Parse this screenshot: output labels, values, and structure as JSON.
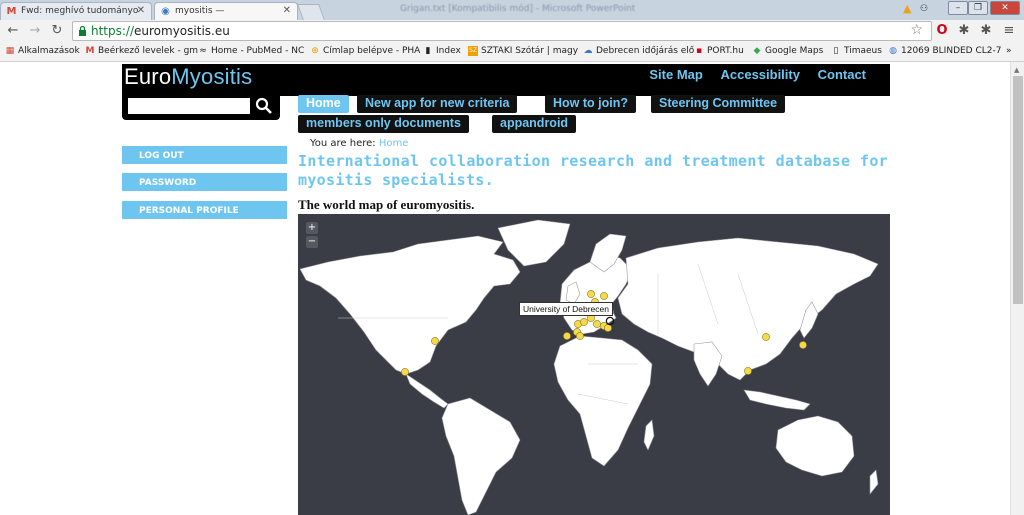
{
  "browser": {
    "tabs": [
      {
        "title": "Fwd: meghívó tudományo",
        "icon": "gmail-icon"
      },
      {
        "title": "myositis —",
        "icon": "page-icon"
      }
    ],
    "window_title": "Grigan.txt [Kompatibilis mód] - Microsoft PowerPoint",
    "url_scheme": "https://",
    "url_host": "euromyositis.eu",
    "bookmarks": [
      {
        "label": "Alkalmazások",
        "icon": "apps-icon"
      },
      {
        "label": "Beérkező levelek - gm",
        "icon": "gmail-icon"
      },
      {
        "label": "Home - PubMed - NC",
        "icon": "pubmed-icon"
      },
      {
        "label": "Címlap belépve - PHA",
        "icon": "plus-icon"
      },
      {
        "label": "Index",
        "icon": "index-icon"
      },
      {
        "label": "SZTAKI Szótár | magy",
        "icon": "sztaki-icon"
      },
      {
        "label": "Debrecen időjárás elő",
        "icon": "weather-icon"
      },
      {
        "label": "PORT.hu",
        "icon": "port-icon"
      },
      {
        "label": "Google Maps",
        "icon": "maps-icon"
      },
      {
        "label": "Timaeus",
        "icon": "doc-icon"
      },
      {
        "label": "12069 BLINDED CL2-7",
        "icon": "globe-icon"
      }
    ],
    "more": "»"
  },
  "site": {
    "logo_part1": "Euro",
    "logo_part2": "Myositis",
    "topnav": [
      "Site Map",
      "Accessibility",
      "Contact"
    ],
    "menu": [
      "Home",
      "New app for new criteria",
      "How to join?",
      "Steering Committee",
      "members only documents",
      "appandroid"
    ],
    "breadcrumb_prefix": "You are here:",
    "breadcrumb_link": "Home",
    "tagline": "International collaboration research and treatment database for myositis specialists.",
    "sidebar": [
      "LOG OUT",
      "PASSWORD",
      "PERSONAL PROFILE"
    ],
    "map_title": "The world map of euromyositis.",
    "zoom_in": "+",
    "zoom_out": "−",
    "tooltip": "University of Debrecen",
    "accent_color": "#6ec6f0",
    "marker_color": "#f5d94a"
  }
}
